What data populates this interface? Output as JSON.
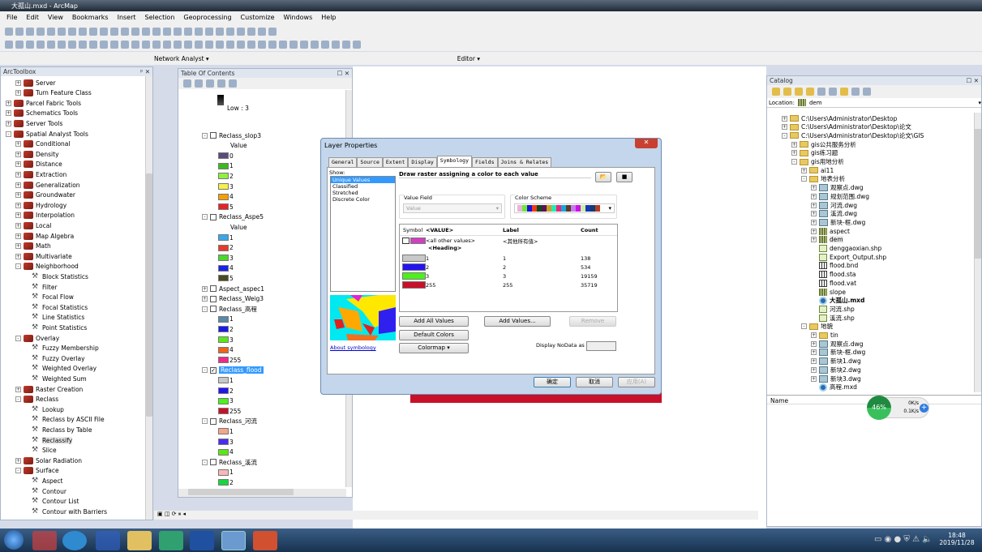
{
  "window": {
    "title": "大孤山.mxd - ArcMap"
  },
  "menu": [
    "File",
    "Edit",
    "View",
    "Bookmarks",
    "Insert",
    "Selection",
    "Geoprocessing",
    "Customize",
    "Windows",
    "Help"
  ],
  "toolbars": {
    "network_analyst": "Network Analyst ▾",
    "editor": "Editor ▾"
  },
  "arctoolbox": {
    "title": "ArcToolbox",
    "items": [
      {
        "l": 1,
        "t": "set",
        "e": "+",
        "label": "Server"
      },
      {
        "l": 1,
        "t": "set",
        "e": "+",
        "label": "Turn Feature Class"
      },
      {
        "l": 0,
        "t": "box",
        "e": "+",
        "label": "Parcel Fabric Tools"
      },
      {
        "l": 0,
        "t": "box",
        "e": "+",
        "label": "Schematics Tools"
      },
      {
        "l": 0,
        "t": "box",
        "e": "+",
        "label": "Server Tools"
      },
      {
        "l": 0,
        "t": "box",
        "e": "-",
        "label": "Spatial Analyst Tools"
      },
      {
        "l": 1,
        "t": "set",
        "e": "+",
        "label": "Conditional"
      },
      {
        "l": 1,
        "t": "set",
        "e": "+",
        "label": "Density"
      },
      {
        "l": 1,
        "t": "set",
        "e": "+",
        "label": "Distance"
      },
      {
        "l": 1,
        "t": "set",
        "e": "+",
        "label": "Extraction"
      },
      {
        "l": 1,
        "t": "set",
        "e": "+",
        "label": "Generalization"
      },
      {
        "l": 1,
        "t": "set",
        "e": "+",
        "label": "Groundwater"
      },
      {
        "l": 1,
        "t": "set",
        "e": "+",
        "label": "Hydrology"
      },
      {
        "l": 1,
        "t": "set",
        "e": "+",
        "label": "Interpolation"
      },
      {
        "l": 1,
        "t": "set",
        "e": "+",
        "label": "Local"
      },
      {
        "l": 1,
        "t": "set",
        "e": "+",
        "label": "Map Algebra"
      },
      {
        "l": 1,
        "t": "set",
        "e": "+",
        "label": "Math"
      },
      {
        "l": 1,
        "t": "set",
        "e": "+",
        "label": "Multivariate"
      },
      {
        "l": 1,
        "t": "set",
        "e": "-",
        "label": "Neighborhood"
      },
      {
        "l": 2,
        "t": "tool",
        "label": "Block Statistics"
      },
      {
        "l": 2,
        "t": "tool",
        "label": "Filter"
      },
      {
        "l": 2,
        "t": "tool",
        "label": "Focal Flow"
      },
      {
        "l": 2,
        "t": "tool",
        "label": "Focal Statistics"
      },
      {
        "l": 2,
        "t": "tool",
        "label": "Line Statistics"
      },
      {
        "l": 2,
        "t": "tool",
        "label": "Point Statistics"
      },
      {
        "l": 1,
        "t": "set",
        "e": "-",
        "label": "Overlay"
      },
      {
        "l": 2,
        "t": "tool",
        "label": "Fuzzy Membership"
      },
      {
        "l": 2,
        "t": "tool",
        "label": "Fuzzy Overlay"
      },
      {
        "l": 2,
        "t": "tool",
        "label": "Weighted Overlay"
      },
      {
        "l": 2,
        "t": "tool",
        "label": "Weighted Sum"
      },
      {
        "l": 1,
        "t": "set",
        "e": "+",
        "label": "Raster Creation"
      },
      {
        "l": 1,
        "t": "set",
        "e": "-",
        "label": "Reclass"
      },
      {
        "l": 2,
        "t": "tool",
        "label": "Lookup"
      },
      {
        "l": 2,
        "t": "tool",
        "label": "Reclass by ASCII File"
      },
      {
        "l": 2,
        "t": "tool",
        "label": "Reclass by Table"
      },
      {
        "l": 2,
        "t": "tool",
        "label": "Reclassify"
      },
      {
        "l": 2,
        "t": "tool",
        "label": "Slice"
      },
      {
        "l": 1,
        "t": "set",
        "e": "+",
        "label": "Solar Radiation"
      },
      {
        "l": 1,
        "t": "set",
        "e": "-",
        "label": "Surface"
      },
      {
        "l": 2,
        "t": "tool",
        "label": "Aspect"
      },
      {
        "l": 2,
        "t": "tool",
        "label": "Contour"
      },
      {
        "l": 2,
        "t": "tool",
        "label": "Contour List"
      },
      {
        "l": 2,
        "t": "tool",
        "label": "Contour with Barriers"
      }
    ]
  },
  "toc": {
    "title": "Table Of Contents",
    "ramp_low": "Low : 3",
    "items": [
      {
        "t": "layer",
        "e": "-",
        "label": "Reclass_slop3"
      },
      {
        "t": "head",
        "label": "Value"
      },
      {
        "t": "sw",
        "c": "#5b4a7c",
        "label": "0"
      },
      {
        "t": "sw",
        "c": "#3cba1c",
        "label": "1"
      },
      {
        "t": "sw",
        "c": "#8ef040",
        "label": "2"
      },
      {
        "t": "sw",
        "c": "#f6f04a",
        "label": "3"
      },
      {
        "t": "sw",
        "c": "#f5a000",
        "label": "4"
      },
      {
        "t": "sw",
        "c": "#e82323",
        "label": "5"
      },
      {
        "t": "layer",
        "e": "-",
        "label": "Reclass_Aspe5"
      },
      {
        "t": "head",
        "label": "Value"
      },
      {
        "t": "sw",
        "c": "#3aa6ee",
        "label": "1"
      },
      {
        "t": "sw",
        "c": "#e83a2a",
        "label": "2"
      },
      {
        "t": "sw",
        "c": "#4ad82a",
        "label": "3"
      },
      {
        "t": "sw",
        "c": "#1a22e8",
        "label": "4"
      },
      {
        "t": "sw",
        "c": "#4a4a1e",
        "label": "5"
      },
      {
        "t": "layer",
        "e": "+",
        "label": "Aspect_aspec1"
      },
      {
        "t": "layer",
        "e": "+",
        "label": "Reclass_Weig3"
      },
      {
        "t": "layer",
        "e": "-",
        "label": "Reclass_高程"
      },
      {
        "t": "sw",
        "c": "#5a88a8",
        "label": "1"
      },
      {
        "t": "sw",
        "c": "#1a1ae8",
        "label": "2"
      },
      {
        "t": "sw",
        "c": "#5ae81a",
        "label": "3"
      },
      {
        "t": "sw",
        "c": "#f0641a",
        "label": "4"
      },
      {
        "t": "sw",
        "c": "#f0288a",
        "label": "255"
      },
      {
        "t": "layer",
        "e": "-",
        "label": "Reclass_flood",
        "checked": true,
        "selected": true
      },
      {
        "t": "sw",
        "c": "#c8c8c8",
        "label": "1"
      },
      {
        "t": "sw",
        "c": "#2414f0",
        "label": "2"
      },
      {
        "t": "sw",
        "c": "#4cf01c",
        "label": "3"
      },
      {
        "t": "sw",
        "c": "#c8102a",
        "label": "255"
      },
      {
        "t": "layer",
        "e": "-",
        "label": "Reclass_河流"
      },
      {
        "t": "sw",
        "c": "#f6a48a",
        "label": "1"
      },
      {
        "t": "sw",
        "c": "#4a2cf0",
        "label": "3"
      },
      {
        "t": "sw",
        "c": "#5ae814",
        "label": "4"
      },
      {
        "t": "layer",
        "e": "-",
        "label": "Reclass_溪流"
      },
      {
        "t": "sw",
        "c": "#f6b8b8",
        "label": "1"
      },
      {
        "t": "sw",
        "c": "#14d83c",
        "label": "2"
      }
    ]
  },
  "catalog": {
    "title": "Catalog",
    "location_label": "Location:",
    "location_value": "dem",
    "name_header": "Name",
    "items": [
      {
        "l": 0,
        "i": "folder",
        "e": "+",
        "label": "C:\\Users\\Administrator\\Desktop"
      },
      {
        "l": 0,
        "i": "folder",
        "e": "+",
        "label": "C:\\Users\\Administrator\\Desktop\\论文"
      },
      {
        "l": 0,
        "i": "folder",
        "e": "-",
        "label": "C:\\Users\\Administrator\\Desktop\\论文\\GIS"
      },
      {
        "l": 1,
        "i": "folder",
        "e": "+",
        "label": "gis公共服务分析"
      },
      {
        "l": 1,
        "i": "folder",
        "e": "+",
        "label": "gis练习题"
      },
      {
        "l": 1,
        "i": "folder",
        "e": "-",
        "label": "gis用地分析"
      },
      {
        "l": 2,
        "i": "folder",
        "e": "+",
        "label": "ai11"
      },
      {
        "l": 2,
        "i": "folder",
        "e": "-",
        "label": "地表分析"
      },
      {
        "l": 3,
        "i": "cad",
        "e": "+",
        "label": "观察点.dwg"
      },
      {
        "l": 3,
        "i": "cad",
        "e": "+",
        "label": "规划范围.dwg"
      },
      {
        "l": 3,
        "i": "cad",
        "e": "+",
        "label": "河流.dwg"
      },
      {
        "l": 3,
        "i": "cad",
        "e": "+",
        "label": "溪流.dwg"
      },
      {
        "l": 3,
        "i": "cad",
        "e": "+",
        "label": "新块-框.dwg"
      },
      {
        "l": 3,
        "i": "grid",
        "e": "+",
        "label": "aspect"
      },
      {
        "l": 3,
        "i": "grid",
        "e": "+",
        "label": "dem",
        "sel": true
      },
      {
        "l": 3,
        "i": "shp",
        "label": "denggaoxian.shp"
      },
      {
        "l": 3,
        "i": "shp",
        "label": "Export_Output.shp"
      },
      {
        "l": 3,
        "i": "tbl",
        "label": "flood.bnd"
      },
      {
        "l": 3,
        "i": "tbl",
        "label": "flood.sta"
      },
      {
        "l": 3,
        "i": "tbl",
        "label": "flood.vat"
      },
      {
        "l": 3,
        "i": "grid",
        "label": "slope"
      },
      {
        "l": 3,
        "i": "mxd",
        "label": "大孤山.mxd",
        "bold": true
      },
      {
        "l": 3,
        "i": "shp",
        "label": "河流.shp"
      },
      {
        "l": 3,
        "i": "shp",
        "label": "溪流.shp"
      },
      {
        "l": 2,
        "i": "folder",
        "e": "-",
        "label": "地貌"
      },
      {
        "l": 3,
        "i": "folder",
        "e": "+",
        "label": "tin"
      },
      {
        "l": 3,
        "i": "cad",
        "e": "+",
        "label": "观察点.dwg"
      },
      {
        "l": 3,
        "i": "cad",
        "e": "+",
        "label": "新块-框.dwg"
      },
      {
        "l": 3,
        "i": "cad",
        "e": "+",
        "label": "新块1.dwg"
      },
      {
        "l": 3,
        "i": "cad",
        "e": "+",
        "label": "新块2.dwg"
      },
      {
        "l": 3,
        "i": "cad",
        "e": "+",
        "label": "新块3.dwg"
      },
      {
        "l": 3,
        "i": "mxd",
        "label": "高程.mxd"
      }
    ]
  },
  "dialog": {
    "title": "Layer Properties",
    "tabs": [
      "General",
      "Source",
      "Extent",
      "Display",
      "Symbology",
      "Fields",
      "Joins & Relates"
    ],
    "active_tab": "Symbology",
    "show_label": "Show:",
    "show_options": [
      "Unique Values",
      "Classified",
      "Stretched",
      "Discrete Color"
    ],
    "description": "Draw raster assigning a color to each value",
    "value_field_label": "Value Field",
    "value_field_value": "Value",
    "color_scheme_label": "Color Scheme",
    "color_scheme": [
      "#e8b4d8",
      "#6ee83a",
      "#1a14d8",
      "#f03c14",
      "#0e4a1e",
      "#5a1450",
      "#c8a028",
      "#28e8b4",
      "#e8287a",
      "#14a8d8",
      "#5a3c28",
      "#c878f0",
      "#c814e8",
      "#c8f0a0",
      "#1438b4",
      "#143c6e",
      "#b43c28"
    ],
    "columns": [
      "Symbol",
      "<VALUE>",
      "Label",
      "Count"
    ],
    "other": {
      "color": "#d040c0",
      "value": "<all other values>",
      "label": "<其他所有值>"
    },
    "heading": "<Heading>",
    "rows": [
      {
        "color": "#c8c8c8",
        "value": "1",
        "label": "1",
        "count": "138"
      },
      {
        "color": "#2414f0",
        "value": "2",
        "label": "2",
        "count": "534"
      },
      {
        "color": "#4cf01c",
        "value": "3",
        "label": "3",
        "count": "19159"
      },
      {
        "color": "#c8102a",
        "value": "255",
        "label": "255",
        "count": "35719"
      }
    ],
    "add_all": "Add All Values",
    "add_values": "Add Values...",
    "remove": "Remove",
    "default_colors": "Default Colors",
    "colormap": "Colormap",
    "nodata_label": "Display NoData as",
    "about": "About symbology",
    "ok": "确定",
    "cancel": "取消",
    "apply": "应用(A)"
  },
  "netspeed": {
    "percent": "46%",
    "up": "0K/s",
    "down": "0.1K/s"
  },
  "clock": {
    "time": "18:48",
    "date": "2019/11/28"
  }
}
